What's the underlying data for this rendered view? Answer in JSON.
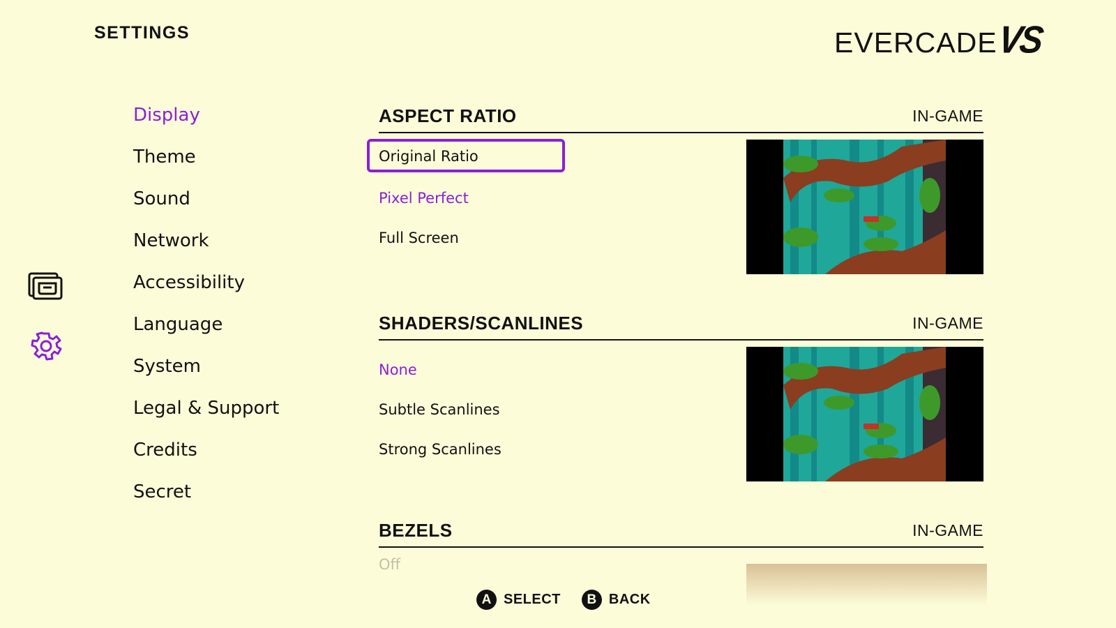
{
  "header": {
    "title": "SETTINGS",
    "brand_text": "EVERCADE",
    "brand_vs": "VS"
  },
  "sidebar": {
    "icons": [
      "cartridge-icon",
      "gear-icon"
    ],
    "accent_color": "#8b1fd6"
  },
  "menu": {
    "items": [
      {
        "label": "Display",
        "active": true
      },
      {
        "label": "Theme"
      },
      {
        "label": "Sound"
      },
      {
        "label": "Network"
      },
      {
        "label": "Accessibility"
      },
      {
        "label": "Language"
      },
      {
        "label": "System"
      },
      {
        "label": "Legal & Support"
      },
      {
        "label": "Credits"
      },
      {
        "label": "Secret"
      }
    ]
  },
  "sections": [
    {
      "title": "ASPECT RATIO",
      "tag": "IN-GAME",
      "options": [
        "Original Ratio",
        "Pixel Perfect",
        "Full Screen"
      ],
      "focused": "Original Ratio",
      "selected": "Pixel Perfect"
    },
    {
      "title": "SHADERS/SCANLINES",
      "tag": "IN-GAME",
      "options": [
        "None",
        "Subtle Scanlines",
        "Strong Scanlines"
      ],
      "selected": "None"
    },
    {
      "title": "BEZELS",
      "tag": "IN-GAME",
      "options": [
        "Off"
      ]
    }
  ],
  "footer": {
    "a_glyph": "A",
    "a_label": "SELECT",
    "b_glyph": "B",
    "b_label": "BACK"
  },
  "colors": {
    "background": "#fdfcd9",
    "accent": "#8b1fd6",
    "text": "#111111"
  }
}
